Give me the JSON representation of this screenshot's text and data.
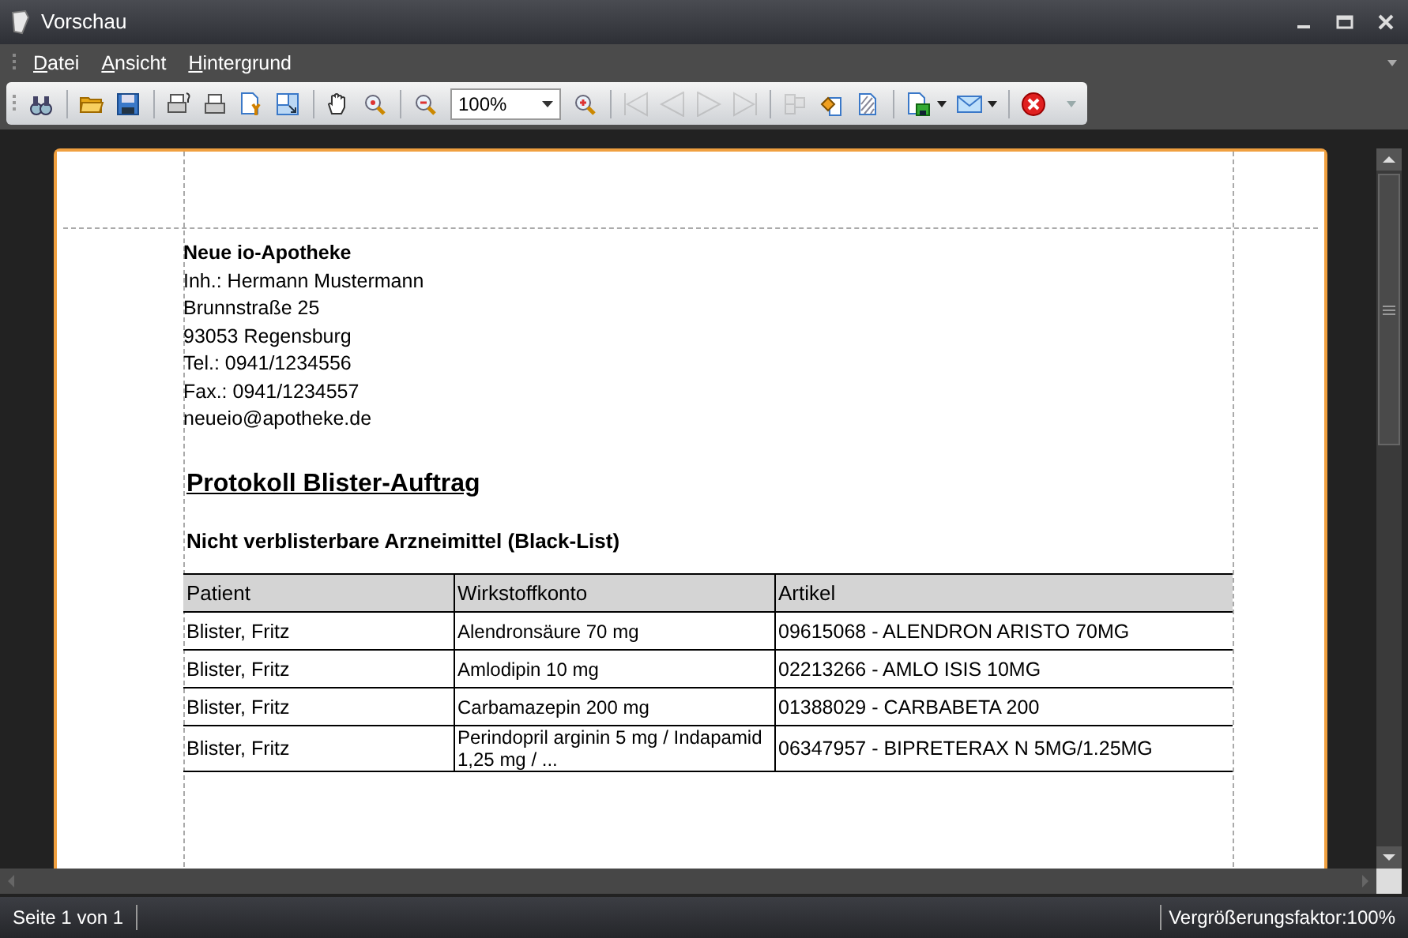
{
  "window": {
    "title": "Vorschau"
  },
  "menu": [
    {
      "label": "Datei"
    },
    {
      "label": "Ansicht"
    },
    {
      "label": "Hintergrund"
    }
  ],
  "toolbar": [
    {
      "kind": "button",
      "disabled": false
    },
    {
      "kind": "separator"
    },
    {
      "kind": "button",
      "disabled": false
    },
    {
      "kind": "button",
      "disabled": false
    },
    {
      "kind": "separator"
    },
    {
      "kind": "button",
      "disabled": false
    },
    {
      "kind": "button",
      "disabled": false
    },
    {
      "kind": "button",
      "disabled": false
    },
    {
      "kind": "button",
      "disabled": false
    },
    {
      "kind": "separator"
    },
    {
      "kind": "button",
      "disabled": false
    },
    {
      "kind": "button",
      "disabled": false
    },
    {
      "kind": "separator"
    },
    {
      "kind": "button",
      "disabled": false
    },
    {
      "kind": "combo",
      "value": "100%"
    },
    {
      "kind": "button",
      "disabled": false
    },
    {
      "kind": "separator"
    },
    {
      "kind": "button",
      "disabled": true
    },
    {
      "kind": "button",
      "disabled": true
    },
    {
      "kind": "button",
      "disabled": true
    },
    {
      "kind": "button",
      "disabled": true
    },
    {
      "kind": "separator"
    },
    {
      "kind": "button",
      "disabled": true
    },
    {
      "kind": "button",
      "disabled": false
    },
    {
      "kind": "button",
      "disabled": false
    },
    {
      "kind": "separator"
    },
    {
      "kind": "dropdown",
      "disabled": false
    },
    {
      "kind": "dropdown",
      "disabled": false
    },
    {
      "kind": "separator"
    },
    {
      "kind": "button",
      "disabled": false
    }
  ],
  "document": {
    "address": [
      {
        "text": "Neue io-Apotheke",
        "bold": true
      },
      {
        "text": "Inh.: Hermann Mustermann",
        "bold": false
      },
      {
        "text": "Brunnstraße 25",
        "bold": false
      },
      {
        "text": "93053 Regensburg",
        "bold": false
      },
      {
        "text": "Tel.: 0941/1234556",
        "bold": false
      },
      {
        "text": "Fax.: 0941/1234557",
        "bold": false
      },
      {
        "text": "neueio@apotheke.de",
        "bold": false
      }
    ],
    "heading": "Protokoll Blister-Auftrag",
    "subheading": "Nicht verblisterbare Arzneimittel (Black-List)",
    "table": {
      "columns": [
        "Patient",
        "Wirkstoffkonto",
        "Artikel"
      ],
      "rows": [
        [
          "Blister, Fritz",
          "Alendronsäure 70 mg",
          "09615068 - ALENDRON ARISTO 70MG"
        ],
        [
          "Blister, Fritz",
          "Amlodipin 10 mg",
          "02213266 - AMLO ISIS 10MG"
        ],
        [
          "Blister, Fritz",
          "Carbamazepin 200 mg",
          "01388029 - CARBABETA 200"
        ],
        [
          "Blister, Fritz",
          "Perindopril arginin 5 mg / Indapamid 1,25 mg / ...",
          "06347957 - BIPRETERAX N 5MG/1.25MG"
        ]
      ]
    }
  },
  "status_bar": {
    "page": "Seite 1 von 1",
    "zoom": "Vergrößerungsfaktor:100%"
  }
}
